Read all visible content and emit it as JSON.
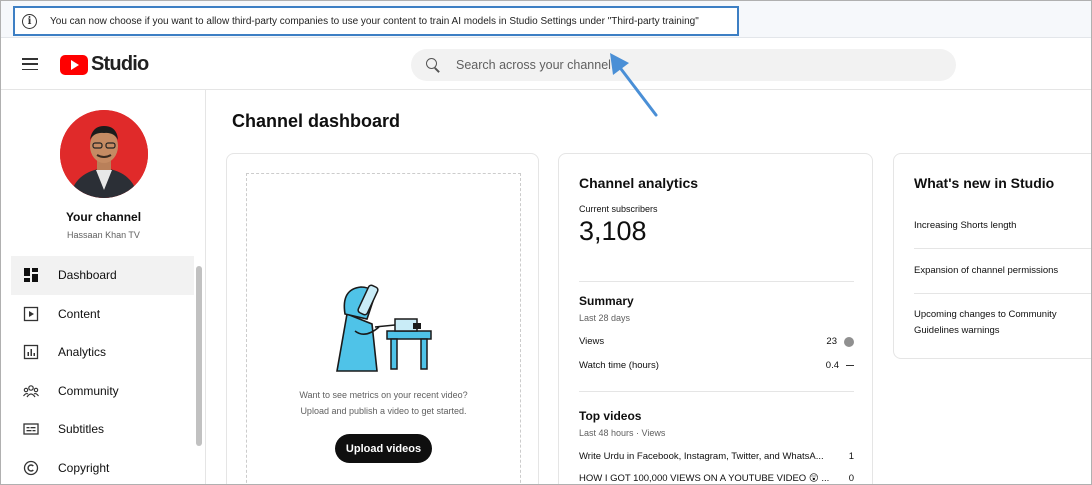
{
  "notice": {
    "text": "You can now choose if you want to allow third-party companies to use your content to train AI models in Studio Settings under \"Third-party training\""
  },
  "header": {
    "logo_text": "Studio",
    "search_placeholder": "Search across your channel"
  },
  "sidebar": {
    "channel_label": "Your channel",
    "channel_name": "Hassaan Khan TV",
    "items": [
      {
        "label": "Dashboard",
        "icon": "dashboard-icon",
        "active": true
      },
      {
        "label": "Content",
        "icon": "content-icon"
      },
      {
        "label": "Analytics",
        "icon": "analytics-icon"
      },
      {
        "label": "Community",
        "icon": "community-icon"
      },
      {
        "label": "Subtitles",
        "icon": "subtitles-icon"
      },
      {
        "label": "Copyright",
        "icon": "copyright-icon"
      }
    ]
  },
  "main": {
    "title": "Channel dashboard",
    "upload_card": {
      "prompt_line1": "Want to see metrics on your recent video?",
      "prompt_line2": "Upload and publish a video to get started.",
      "button": "Upload videos"
    },
    "analytics": {
      "title": "Channel analytics",
      "subscribers_label": "Current subscribers",
      "subscribers": "3,108",
      "summary_title": "Summary",
      "summary_period": "Last 28 days",
      "rows": [
        {
          "label": "Views",
          "value": "23"
        },
        {
          "label": "Watch time (hours)",
          "value": "0.4"
        }
      ],
      "top_videos_title": "Top videos",
      "top_videos_period": "Last 48 hours · Views",
      "videos": [
        {
          "title": "Write Urdu in Facebook, Instagram, Twitter, and WhatsA...",
          "views": "1"
        },
        {
          "title": "HOW I GOT 100,000 VIEWS ON A YOUTUBE VIDEO 😲 ...",
          "views": "0"
        }
      ]
    },
    "whats_new": {
      "title": "What's new in Studio",
      "items": [
        "Increasing Shorts length",
        "Expansion of channel permissions",
        "Upcoming changes to Community Guidelines warnings"
      ]
    }
  },
  "colors": {
    "brand_red": "#ff0000",
    "notice_border": "#3d7fc4",
    "arrow": "#4a8fd6"
  }
}
